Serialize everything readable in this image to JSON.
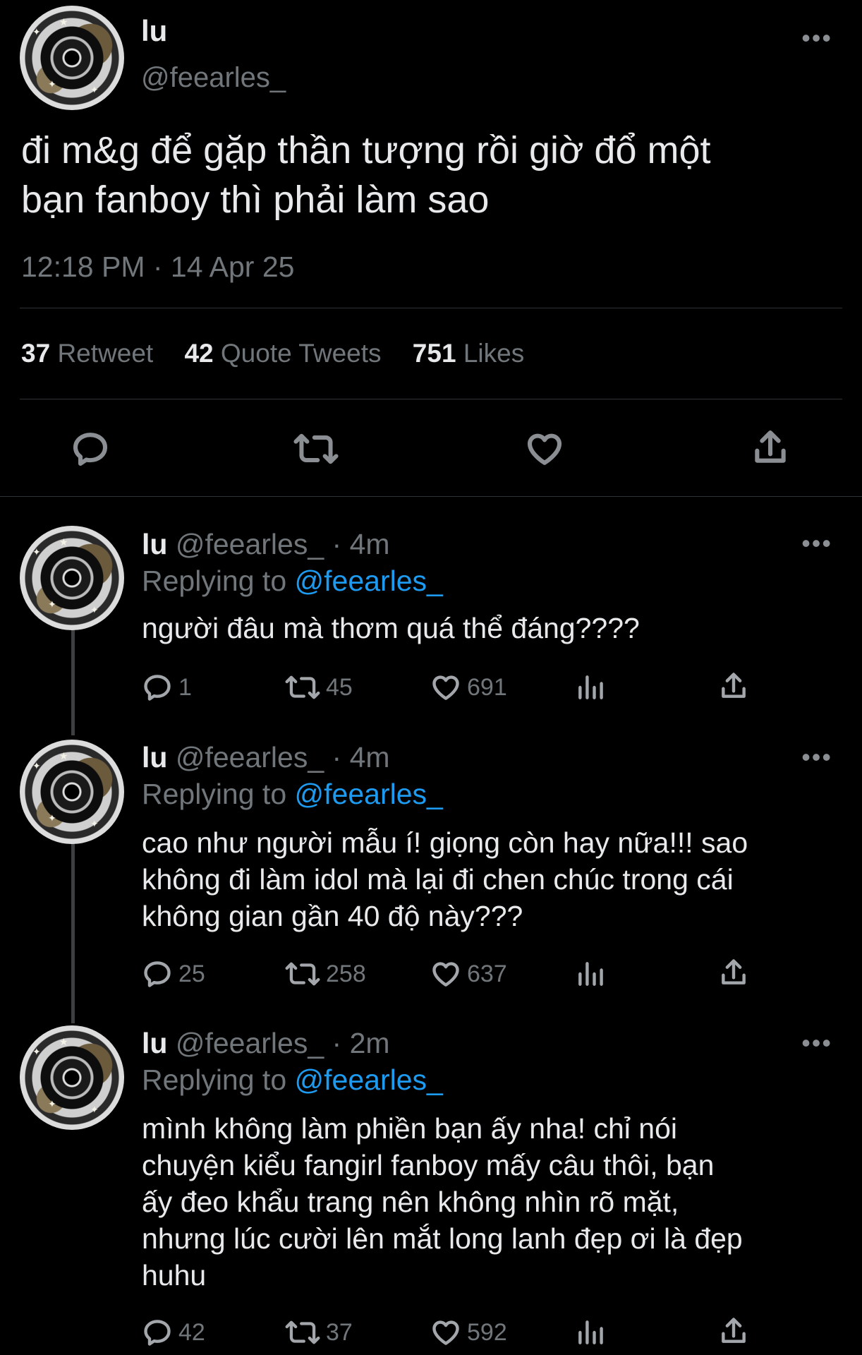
{
  "main_tweet": {
    "display_name": "lu",
    "handle": "@feearles_",
    "text_line1": "đi m&g để gặp thần tượng rồi giờ đổ một",
    "text_line2": "bạn fanboy thì phải làm sao",
    "timestamp": "12:18 PM · 14 Apr 25",
    "retweets_count": "37",
    "retweets_label": "Retweet",
    "quotes_count": "42",
    "quotes_label": "Quote Tweets",
    "likes_count": "751",
    "likes_label": "Likes"
  },
  "replies": [
    {
      "display_name": "lu",
      "meta": "@feearles_ · 4m",
      "replying_label": "Replying to",
      "replying_handle": "@feearles_",
      "text": "người đâu mà thơm quá thể đáng????",
      "reply_count": "1",
      "retweet_count": "45",
      "like_count": "691"
    },
    {
      "display_name": "lu",
      "meta": "@feearles_ · 4m",
      "replying_label": "Replying to",
      "replying_handle": "@feearles_",
      "text_lines": [
        "cao như người mẫu í! giọng còn hay nữa!!! sao",
        "không đi làm idol mà lại đi chen chúc trong cái",
        "không gian gần 40 độ này???"
      ],
      "reply_count": "25",
      "retweet_count": "258",
      "like_count": "637"
    },
    {
      "display_name": "lu",
      "meta": "@feearles_ · 2m",
      "replying_label": "Replying to",
      "replying_handle": "@feearles_",
      "text_lines": [
        "mình không làm phiền bạn ấy nha! chỉ nói",
        "chuyện kiểu fangirl fanboy mấy câu thôi, bạn",
        "ấy đeo khẩu trang nên không nhìn rõ mặt,",
        "nhưng lúc cười lên mắt long lanh đẹp ơi là đẹp",
        "huhu"
      ],
      "reply_count": "42",
      "retweet_count": "37",
      "like_count": "592"
    }
  ],
  "icons": [
    "reply-icon",
    "retweet-icon",
    "like-icon",
    "share-icon",
    "analytics-icon",
    "more-icon"
  ],
  "colors": {
    "background": "#000000",
    "text": "#e7e9ea",
    "muted": "#71767b",
    "link": "#1d9bf0",
    "divider": "#2f3336"
  }
}
